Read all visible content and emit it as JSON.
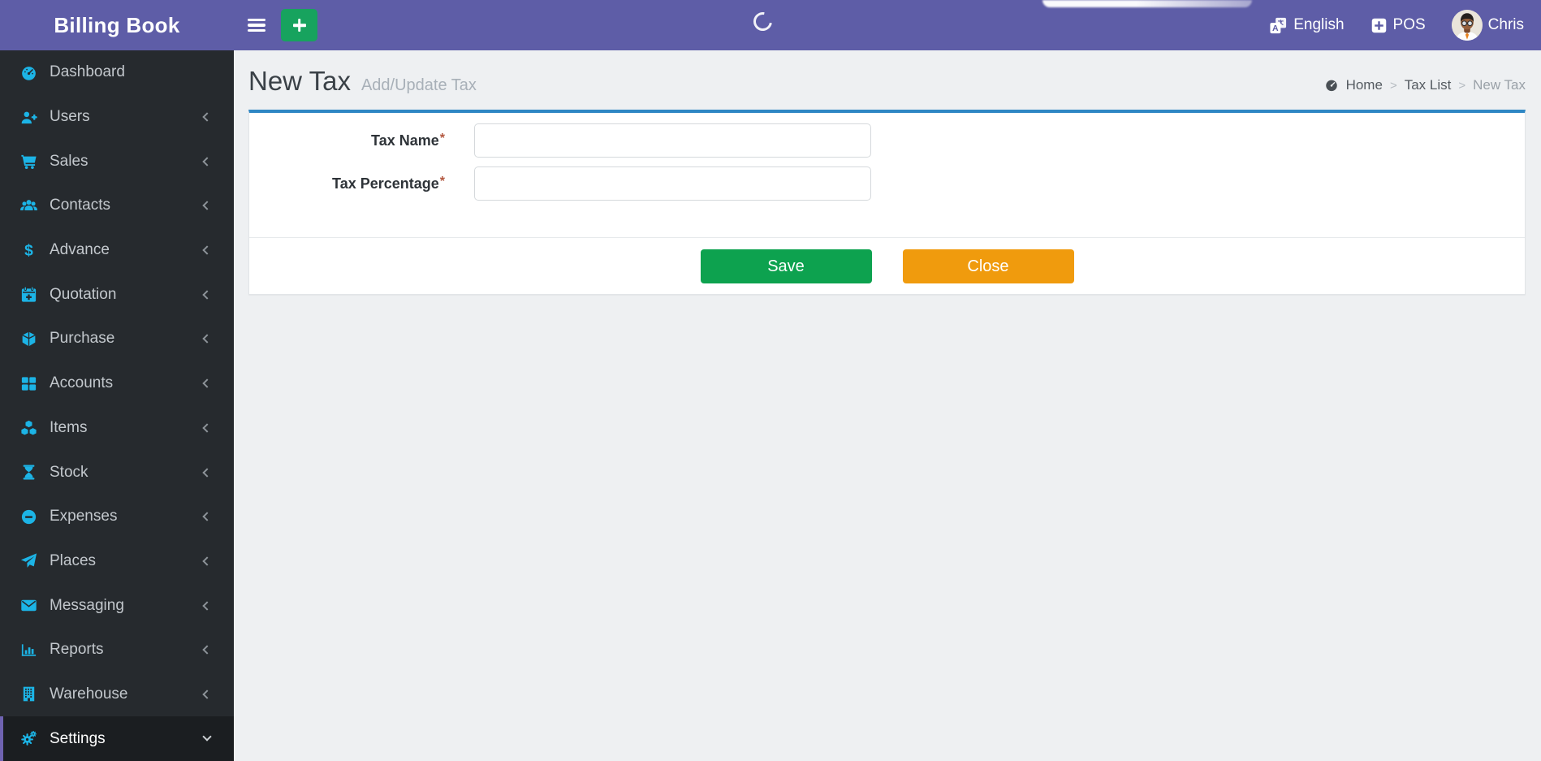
{
  "brand": {
    "title": "Billing Book"
  },
  "topbar": {
    "language": {
      "label": "English",
      "icon": "language-icon"
    },
    "pos": {
      "label": "POS",
      "icon": "plus-square-icon"
    },
    "user": {
      "name": "Chris",
      "icon": "avatar"
    }
  },
  "sidebar": {
    "items": [
      {
        "label": "Dashboard",
        "icon": "tachometer",
        "chevron": "none",
        "active": false
      },
      {
        "label": "Users",
        "icon": "user-plus",
        "chevron": "left",
        "active": false
      },
      {
        "label": "Sales",
        "icon": "shopping-cart",
        "chevron": "left",
        "active": false
      },
      {
        "label": "Contacts",
        "icon": "users",
        "chevron": "left",
        "active": false
      },
      {
        "label": "Advance",
        "icon": "dollar",
        "chevron": "left",
        "active": false
      },
      {
        "label": "Quotation",
        "icon": "calendar-plus",
        "chevron": "left",
        "active": false
      },
      {
        "label": "Purchase",
        "icon": "cube",
        "chevron": "left",
        "active": false
      },
      {
        "label": "Accounts",
        "icon": "grid",
        "chevron": "left",
        "active": false
      },
      {
        "label": "Items",
        "icon": "cubes",
        "chevron": "left",
        "active": false
      },
      {
        "label": "Stock",
        "icon": "hourglass",
        "chevron": "left",
        "active": false
      },
      {
        "label": "Expenses",
        "icon": "minus-circle",
        "chevron": "left",
        "active": false
      },
      {
        "label": "Places",
        "icon": "paper-plane",
        "chevron": "left",
        "active": false
      },
      {
        "label": "Messaging",
        "icon": "envelope",
        "chevron": "left",
        "active": false
      },
      {
        "label": "Reports",
        "icon": "bar-chart",
        "chevron": "left",
        "active": false
      },
      {
        "label": "Warehouse",
        "icon": "building",
        "chevron": "left",
        "active": false
      },
      {
        "label": "Settings",
        "icon": "cogs",
        "chevron": "down",
        "active": true
      }
    ]
  },
  "page": {
    "title": "New Tax",
    "subtitle": "Add/Update Tax"
  },
  "breadcrumb": {
    "items": [
      "Home",
      "Tax List",
      "New Tax"
    ],
    "separator": ">"
  },
  "form": {
    "fields": [
      {
        "label": "Tax Name",
        "required_mark": "*",
        "value": ""
      },
      {
        "label": "Tax Percentage",
        "required_mark": "*",
        "value": ""
      }
    ],
    "buttons": {
      "save": "Save",
      "close": "Close"
    }
  },
  "colors": {
    "topbar_purple": "#5e5da7",
    "sidebar_dark": "#262a2e",
    "sidebar_active_bg": "#1b1e21",
    "sidebar_accent_border": "#6f63b1",
    "icon_cyan": "#1cb4e6",
    "card_accent_blue": "#2e87c4",
    "save_green": "#0da24f",
    "close_orange": "#f09b0d",
    "add_button_green": "#17a35e",
    "required_mark_red": "#b3573f",
    "page_bg": "#eef0f2"
  }
}
